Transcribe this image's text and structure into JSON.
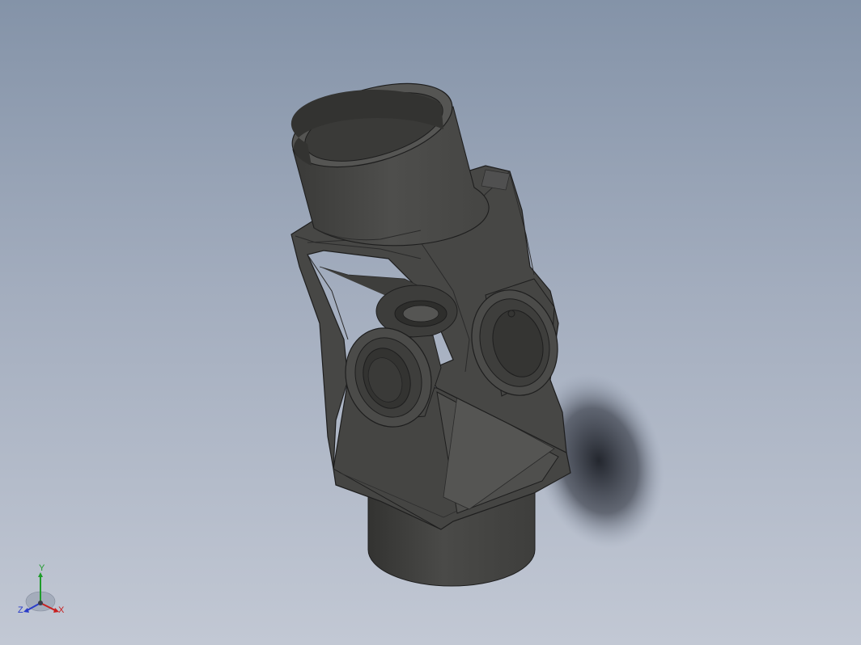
{
  "viewport": {
    "background_top": "#8493a8",
    "background_bottom": "#c2c8d4"
  },
  "model": {
    "description_icon": "universal-joint-model",
    "body_color": "#4a4a48",
    "edge_color": "#1e1e1e"
  },
  "triad": {
    "x_label": "X",
    "y_label": "Y",
    "z_label": "Z",
    "x_color": "#c81e1e",
    "y_color": "#1e9b2a",
    "z_color": "#2a3cc8"
  }
}
